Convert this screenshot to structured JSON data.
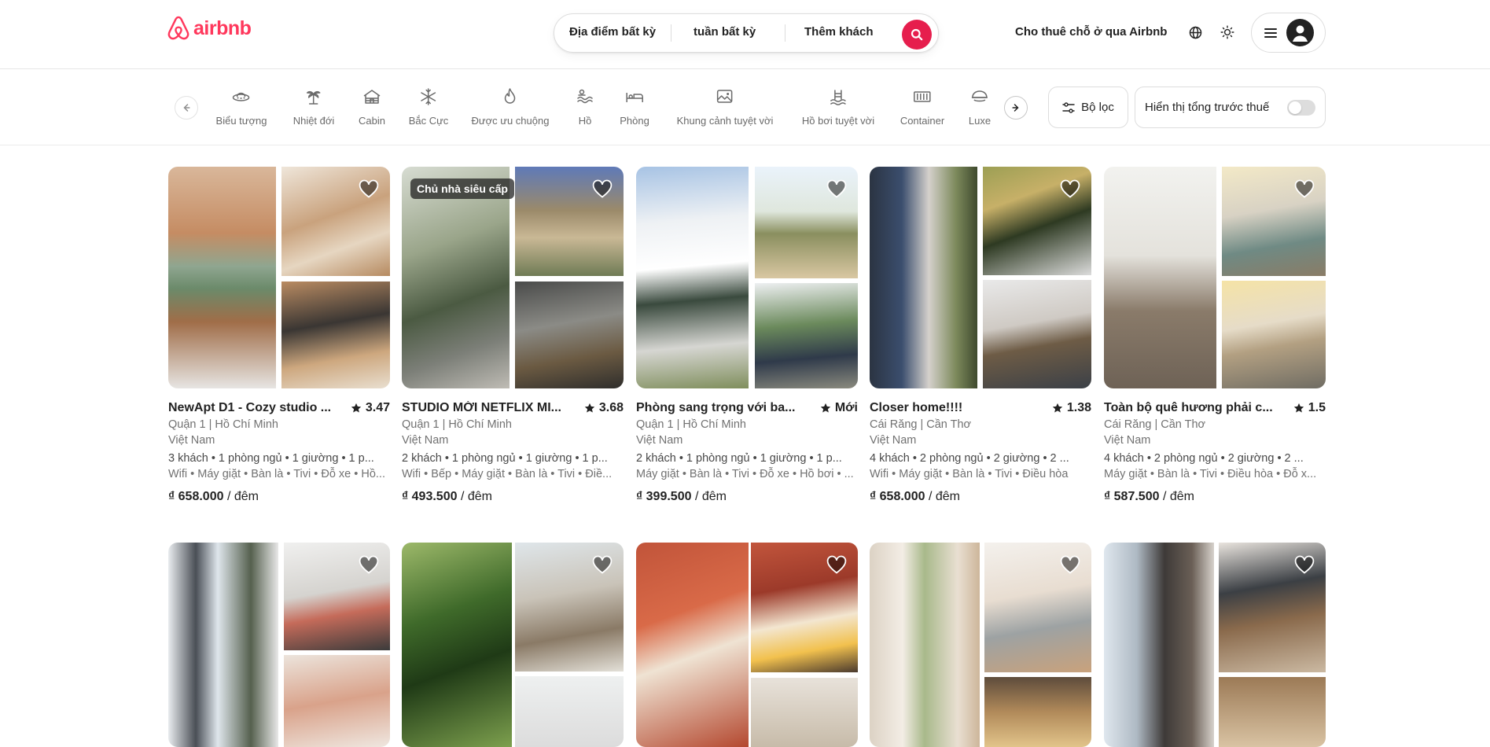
{
  "brand": {
    "name": "airbnb",
    "color": "#ff385c"
  },
  "search": {
    "where": "Địa điểm bất kỳ",
    "when": "tuần bất kỳ",
    "who": "Thêm khách",
    "button_icon": "search-icon",
    "button_color": "#e61e4d"
  },
  "header": {
    "host_link": "Cho thuê chỗ ở qua Airbnb",
    "globe_icon": "globe-icon",
    "theme_icon": "sun-icon",
    "menu_icon": "hamburger-icon",
    "avatar_icon": "user-icon"
  },
  "categories": [
    {
      "label": "Biểu tượng",
      "icon": "ufo-icon"
    },
    {
      "label": "Nhiệt đới",
      "icon": "palm-tree-icon"
    },
    {
      "label": "Cabin",
      "icon": "cabin-icon"
    },
    {
      "label": "Bắc Cực",
      "icon": "snowflake-icon"
    },
    {
      "label": "Được ưu chuộng",
      "icon": "flame-icon"
    },
    {
      "label": "Hồ",
      "icon": "lake-icon"
    },
    {
      "label": "Phòng",
      "icon": "bed-icon"
    },
    {
      "label": "Khung cảnh tuyệt vời",
      "icon": "view-icon"
    },
    {
      "label": "Hồ bơi tuyệt vời",
      "icon": "pool-icon"
    },
    {
      "label": "Container",
      "icon": "container-icon"
    },
    {
      "label": "Luxe",
      "icon": "luxe-icon"
    }
  ],
  "filters": {
    "filter_label": "Bộ lọc",
    "tax_label": "Hiển thị tổng trước thuế",
    "tax_toggle_on": false
  },
  "listings": [
    {
      "title": "NewApt D1 - Cozy studio ...",
      "rating": "3.47",
      "location": "Quận 1 | Hồ Chí Minh",
      "country": "Việt Nam",
      "features": "3 khách • 1 phòng ngủ • 1 giường • 1 p...",
      "amenities": "Wifi • Máy giặt • Bàn là • Tivi • Đỗ xe • Hồ...",
      "price": "₫ 658.000",
      "unit": "/ đêm",
      "badge": ""
    },
    {
      "title": "STUDIO MỚI NETFLIX MI...",
      "rating": "3.68",
      "location": "Quận 1 | Hồ Chí Minh",
      "country": "Việt Nam",
      "features": "2 khách • 1 phòng ngủ • 1 giường • 1 p...",
      "amenities": "Wifi • Bếp • Máy giặt • Bàn là • Tivi • Điề...",
      "price": "₫ 493.500",
      "unit": "/ đêm",
      "badge": "Chủ nhà siêu cấp"
    },
    {
      "title": "Phòng sang trọng với ba...",
      "rating": "Mới",
      "location": "Quận 1 | Hồ Chí Minh",
      "country": "Việt Nam",
      "features": "2 khách • 1 phòng ngủ • 1 giường • 1 p...",
      "amenities": "Máy giặt • Bàn là • Tivi • Đỗ xe • Hồ bơi • ...",
      "price": "₫ 399.500",
      "unit": "/ đêm",
      "badge": ""
    },
    {
      "title": "Closer home!!!!",
      "rating": "1.38",
      "location": "Cái Răng | Cần Thơ",
      "country": "Việt Nam",
      "features": "4 khách • 2 phòng ngủ • 2 giường • 2 ...",
      "amenities": "Wifi • Máy giặt • Bàn là • Tivi • Điều hòa",
      "price": "₫ 658.000",
      "unit": "/ đêm",
      "badge": ""
    },
    {
      "title": "Toàn bộ quê hương phải c...",
      "rating": "1.5",
      "location": "Cái Răng | Cần Thơ",
      "country": "Việt Nam",
      "features": "4 khách • 2 phòng ngủ • 2 giường • 2 ...",
      "amenities": "Máy giặt • Bàn là • Tivi • Điều hòa • Đỗ x...",
      "price": "₫ 587.500",
      "unit": "/ đêm",
      "badge": ""
    }
  ]
}
